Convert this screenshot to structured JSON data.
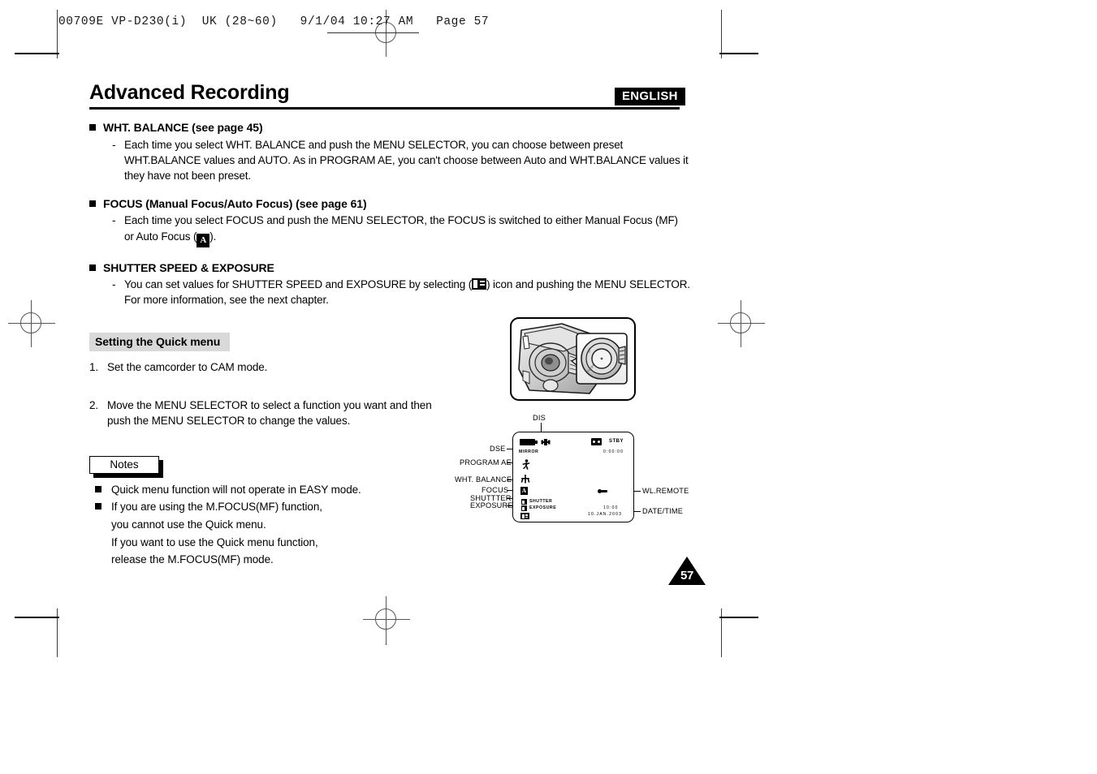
{
  "print_slug": {
    "text": "00709E VP-D230(i)  UK (28~60)   9/1/04 10:27 AM   Page 57"
  },
  "header": {
    "language_badge": "ENGLISH",
    "title": "Advanced Recording"
  },
  "sections": [
    {
      "heading": "WHT. BALANCE (see page 45)",
      "dash": "-",
      "body": "Each time you select WHT. BALANCE and push the MENU SELECTOR, you can choose between preset WHT.BALANCE values and AUTO. As in PROGRAM AE, you can't choose between Auto and WHT.BALANCE values it they have not been preset."
    },
    {
      "heading": "FOCUS (Manual Focus/Auto Focus) (see page 61)",
      "dash": "-",
      "body_part1": "Each time you select FOCUS and push the MENU SELECTOR, the FOCUS is switched to either Manual Focus (MF) or Auto Focus (",
      "inline_icon": "A",
      "body_part2": ")."
    },
    {
      "heading": "SHUTTER SPEED & EXPOSURE",
      "dash": "-",
      "body_part1": "You can set values for SHUTTER SPEED and EXPOSURE by selecting (",
      "inline_icon": "shutter-exposure-icon",
      "body_part2": ") icon and pushing the MENU SELECTOR. For more information, see the next chapter."
    }
  ],
  "quick_menu": {
    "sub_heading": "Setting the Quick menu",
    "steps": [
      {
        "num": "1.",
        "text": "Set the camcorder to CAM mode."
      },
      {
        "num": "2.",
        "text": "Move the MENU SELECTOR to select a function you want and then push the MENU SELECTOR to change the values."
      }
    ]
  },
  "notes": {
    "label": "Notes",
    "items": [
      {
        "lines": [
          "Quick menu function will not operate in EASY mode."
        ]
      },
      {
        "lines": [
          "If you are using the M.FOCUS(MF) function,",
          "you cannot use the Quick menu.",
          "If you want to use the Quick menu function,",
          "release the M.FOCUS(MF) mode."
        ]
      }
    ]
  },
  "osd_diagram": {
    "labels_left": [
      "DSE",
      "PROGRAM AE",
      "WHT. BALANCE",
      "FOCUS",
      "SHUTTTER",
      "EXPOSURE"
    ],
    "label_top": "DIS",
    "labels_right": [
      "WL.REMOTE",
      "DATE/TIME"
    ],
    "screen_text": {
      "dse_mode": "MIRROR",
      "record_mode": "STBY",
      "timecode": "0:00:00",
      "shutter_text": "SHUTTER",
      "exposure_text": "EXPOSURE",
      "time": "10:00",
      "date": "10.JAN.2003"
    },
    "icons": {
      "battery": "battery-icon",
      "dis": "dis-hand-icon",
      "tape": "tape-icon",
      "program_ae": "program-ae-sports-icon",
      "white_balance": "white-balance-icon",
      "focus": "auto-focus-a-icon",
      "shutter": "shutter-icon",
      "exposure": "exposure-icon",
      "exposure_value": "exposure-value-icon",
      "remote": "wl-remote-icon"
    }
  },
  "figure": {
    "camcorder_caption": "camcorder-menu-selector-figure"
  },
  "page_number": "57",
  "colors": {
    "accent": "#000000",
    "grey_heading_bg": "#d9d9d9",
    "crop_mark": "#555555"
  }
}
